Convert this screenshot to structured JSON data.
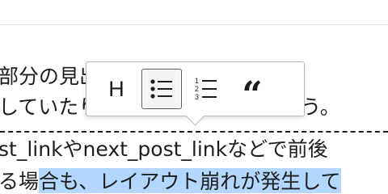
{
  "text": {
    "line1": "部分の見出しが表示されていない",
    "line2": "していたりしないか確認しましょう。",
    "line3": "st_linkやnext_post_linkなどで前後",
    "line4_pre": "る場",
    "line4_sel": "合も、レイアウト崩れが発生して"
  },
  "toolbar": {
    "heading_label": "H",
    "quote_label": "“",
    "list_icon": "bullet-list-icon",
    "ordered_list_icon": "numbered-list-icon",
    "active_color": "#5a5a5a",
    "selection_color": "#b3d7ff"
  }
}
